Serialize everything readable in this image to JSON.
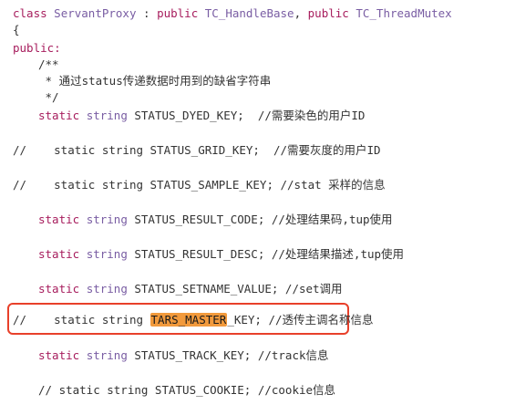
{
  "code": {
    "class_kw": "class",
    "class_name": "ServantProxy",
    "colon": " : ",
    "public1": "public",
    "base1": "TC_HandleBase",
    "comma": ", ",
    "public2": "public",
    "base2": "TC_ThreadMutex",
    "open_brace": "{",
    "public_label": "public:",
    "doc_open": "/**",
    "doc_body": " * 通过status传递数据时用到的缺省字符串",
    "doc_close": " */",
    "lines": [
      {
        "indent": "    ",
        "kw": "static",
        "type": "string",
        "rest": " STATUS_DYED_KEY;  //需要染色的用户ID"
      },
      {
        "prefix": "//    ",
        "text": "static string STATUS_GRID_KEY;  //需要灰度的用户ID"
      },
      {
        "prefix": "//    ",
        "text": "static string STATUS_SAMPLE_KEY; //stat 采样的信息"
      },
      {
        "indent": "    ",
        "kw": "static",
        "type": "string",
        "rest": " STATUS_RESULT_CODE; //处理结果码,tup使用"
      },
      {
        "indent": "    ",
        "kw": "static",
        "type": "string",
        "rest": " STATUS_RESULT_DESC; //处理结果描述,tup使用"
      },
      {
        "indent": "    ",
        "kw": "static",
        "type": "string",
        "rest": " STATUS_SETNAME_VALUE; //set调用"
      },
      {
        "prefix": "//    ",
        "text_before": "static string ",
        "highlight": "TARS_MASTER",
        "text_after": "_KEY; //透传主调名称信息"
      },
      {
        "indent": "    ",
        "kw": "static",
        "type": "string",
        "rest": " STATUS_TRACK_KEY; //track信息"
      },
      {
        "indent": "    ",
        "text": "// static string STATUS_COOKIE; //cookie信息"
      }
    ]
  },
  "colors": {
    "keyword": "#a71d5d",
    "type": "#795da3",
    "highlight": "#f29a3c",
    "box": "#e8402a"
  }
}
